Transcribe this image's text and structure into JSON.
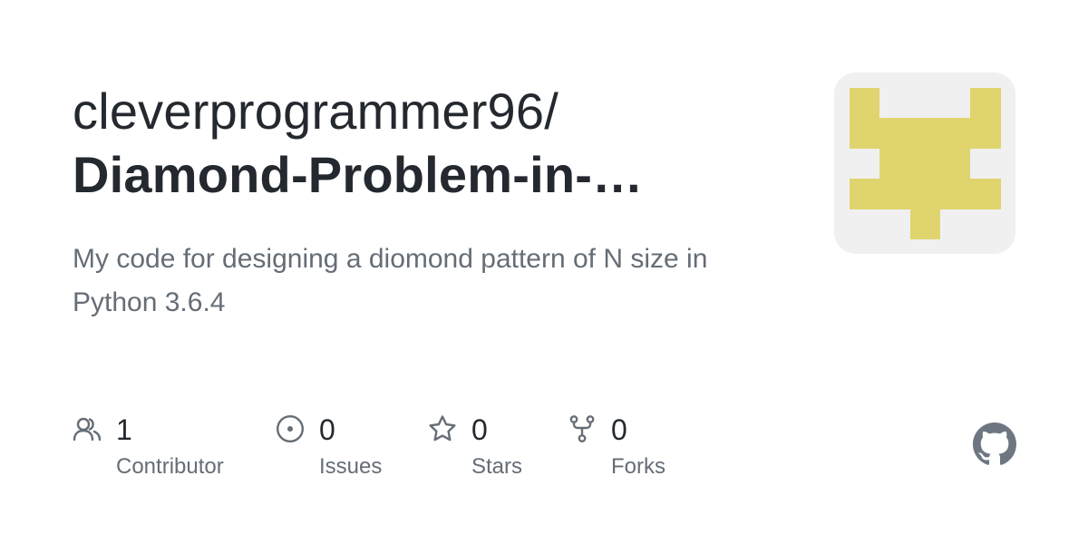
{
  "repo": {
    "owner": "cleverprogrammer96/",
    "name": "Diamond-Problem-in-…",
    "description": "My code for designing a diomond pattern of N size in Python 3.6.4"
  },
  "stats": [
    {
      "icon": "contributors-icon",
      "count": "1",
      "label": "Contributor"
    },
    {
      "icon": "issues-icon",
      "count": "0",
      "label": "Issues"
    },
    {
      "icon": "star-icon",
      "count": "0",
      "label": "Stars"
    },
    {
      "icon": "fork-icon",
      "count": "0",
      "label": "Forks"
    }
  ],
  "avatar": {
    "background": "#f0f0f0",
    "accent": "#e0d46e"
  },
  "colors": {
    "text": "#24292f",
    "muted": "#656d76",
    "github_mark": "#6e7781"
  }
}
